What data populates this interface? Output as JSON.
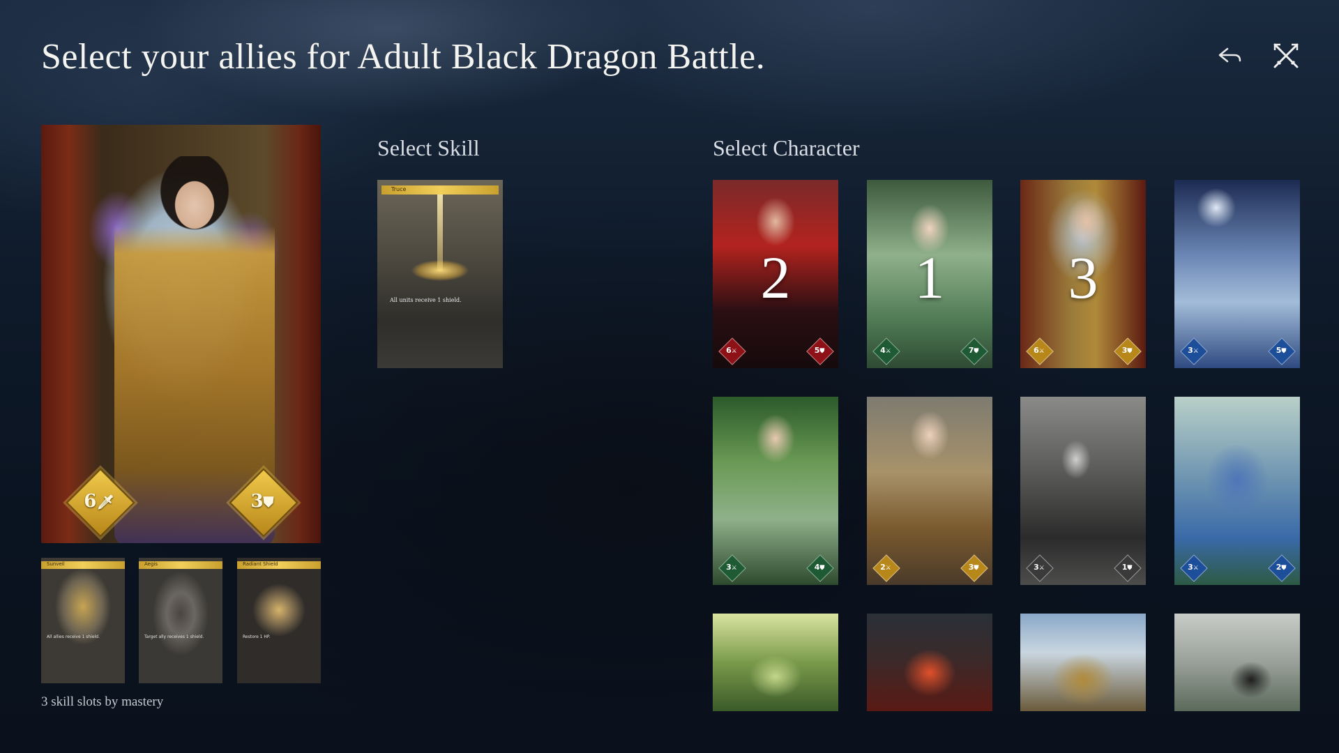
{
  "title": "Select your allies for Adult Black Dragon Battle.",
  "selected_character": {
    "attack": "6",
    "defense": "3"
  },
  "skill_slots": [
    {
      "name": "Sunveil",
      "description": "All allies receive 1 shield."
    },
    {
      "name": "Aegis",
      "description": "Target ally receives 1 shield."
    },
    {
      "name": "Radiant Shield",
      "description": "Restore 1 HP."
    }
  ],
  "skill_slots_caption": "3 skill slots by mastery",
  "skills": {
    "heading": "Select Skill",
    "items": [
      {
        "name": "Truce",
        "description": "All units receive 1 shield."
      }
    ]
  },
  "characters": {
    "heading": "Select Character",
    "items": [
      {
        "order": "2",
        "attack": "6",
        "defense": "5",
        "color": "#8e1117"
      },
      {
        "order": "1",
        "attack": "4",
        "defense": "7",
        "color": "#1e5b35"
      },
      {
        "order": "3",
        "attack": "6",
        "defense": "3",
        "color": "#b8871a"
      },
      {
        "order": "",
        "attack": "3",
        "defense": "5",
        "color": "#1c4e9a"
      },
      {
        "order": "",
        "attack": "3",
        "defense": "4",
        "color": "#1e5b35"
      },
      {
        "order": "",
        "attack": "2",
        "defense": "3",
        "color": "#b8871a"
      },
      {
        "order": "",
        "attack": "3",
        "defense": "1",
        "color": "#3a3a3a"
      },
      {
        "order": "",
        "attack": "3",
        "defense": "2",
        "color": "#1c4e9a"
      },
      {
        "order": "",
        "attack": "",
        "defense": ""
      },
      {
        "order": "",
        "attack": "",
        "defense": ""
      },
      {
        "order": "",
        "attack": "",
        "defense": ""
      },
      {
        "order": "",
        "attack": "",
        "defense": ""
      }
    ]
  },
  "icons": {
    "back": "back-arrow-icon",
    "battle": "crossed-swords-icon"
  }
}
